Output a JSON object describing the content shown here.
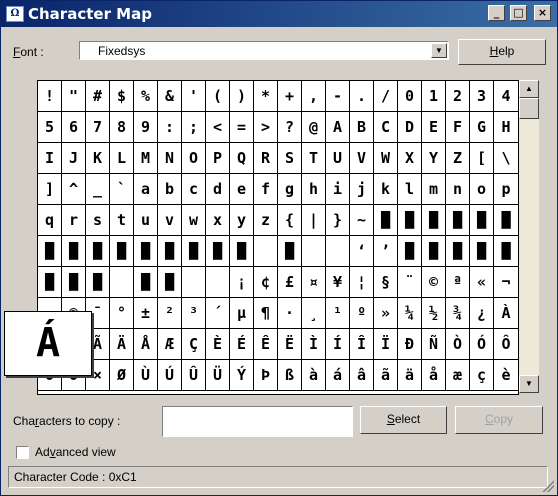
{
  "window": {
    "title": "Character Map",
    "icon": "charmap-app-icon",
    "controls": {
      "minimize": "_",
      "maximize": "□",
      "close": "×"
    }
  },
  "font": {
    "label_pre": "",
    "label_key": "F",
    "label_post": "ont :",
    "value": "Fixedsys",
    "dropdown_glyph": "▼"
  },
  "help_button": {
    "pre": "",
    "key": "H",
    "post": "elp"
  },
  "grid": {
    "columns": 20,
    "rows": [
      [
        "!",
        "\"",
        "#",
        "$",
        "%",
        "&",
        "'",
        "(",
        ")",
        "*",
        "+",
        ",",
        "-",
        ".",
        "/",
        "0",
        "1",
        "2",
        "3",
        "4"
      ],
      [
        "5",
        "6",
        "7",
        "8",
        "9",
        ":",
        ";",
        "<",
        "=",
        ">",
        "?",
        "@",
        "A",
        "B",
        "C",
        "D",
        "E",
        "F",
        "G",
        "H"
      ],
      [
        "I",
        "J",
        "K",
        "L",
        "M",
        "N",
        "O",
        "P",
        "Q",
        "R",
        "S",
        "T",
        "U",
        "V",
        "W",
        "X",
        "Y",
        "Z",
        "[",
        "\\"
      ],
      [
        "]",
        "^",
        "_",
        "`",
        "a",
        "b",
        "c",
        "d",
        "e",
        "f",
        "g",
        "h",
        "i",
        "j",
        "k",
        "l",
        "m",
        "n",
        "o",
        "p"
      ],
      [
        "q",
        "r",
        "s",
        "t",
        "u",
        "v",
        "w",
        "x",
        "y",
        "z",
        "{",
        "|",
        "}",
        "~",
        "█",
        "█",
        "█",
        "█",
        "█",
        "█"
      ],
      [
        "█",
        "█",
        "█",
        "█",
        "█",
        "█",
        "█",
        "█",
        "█",
        "",
        "█",
        "",
        "",
        "‘",
        "’",
        "█",
        "█",
        "█",
        "█",
        "█"
      ],
      [
        "█",
        "█",
        "█",
        "",
        "█",
        "█",
        "",
        "",
        "¡",
        "¢",
        "£",
        "¤",
        "¥",
        "¦",
        "§",
        "¨",
        "©",
        "ª",
        "«",
        "¬"
      ],
      [
        "-",
        "®",
        "¯",
        "°",
        "±",
        "²",
        "³",
        "´",
        "µ",
        "¶",
        "·",
        "¸",
        "¹",
        "º",
        "»",
        "¼",
        "½",
        "¾",
        "¿",
        "À"
      ],
      [
        "Á",
        "Â",
        "Ã",
        "Ä",
        "Å",
        "Æ",
        "Ç",
        "È",
        "É",
        "Ê",
        "Ë",
        "Ì",
        "Í",
        "Î",
        "Ï",
        "Ð",
        "Ñ",
        "Ò",
        "Ó",
        "Ô"
      ],
      [
        "Õ",
        "Ö",
        "×",
        "Ø",
        "Ù",
        "Ú",
        "Û",
        "Ü",
        "Ý",
        "Þ",
        "ß",
        "à",
        "á",
        "â",
        "ã",
        "ä",
        "å",
        "æ",
        "ç",
        "è"
      ]
    ],
    "magnified_char": "Á"
  },
  "scrollbar": {
    "up_glyph": "▲",
    "down_glyph": "▼"
  },
  "copy_section": {
    "label_pre": "Cha",
    "label_key": "r",
    "label_post": "acters to copy :",
    "value": "",
    "select_button": {
      "pre": "",
      "key": "S",
      "post": "elect"
    },
    "copy_button": {
      "pre": "",
      "key": "C",
      "post": "opy"
    }
  },
  "advanced_view": {
    "pre": "Ad",
    "key": "v",
    "post": "anced view",
    "checked": false
  },
  "status_bar": {
    "text": "Character Code : 0xC1"
  }
}
